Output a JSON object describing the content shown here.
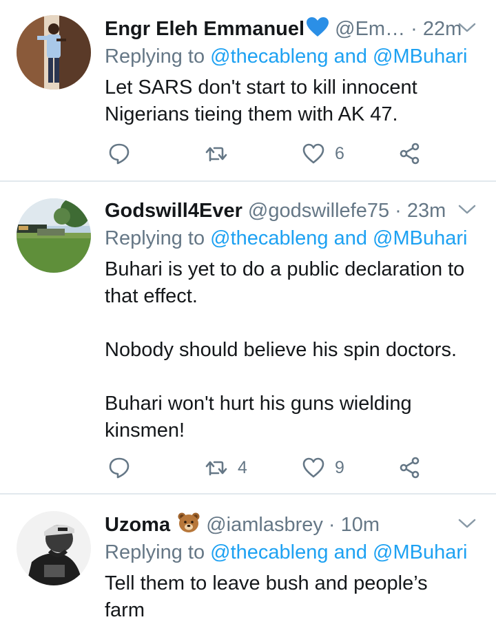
{
  "tweets": [
    {
      "name": "Engr Eleh Emmanuel",
      "badge": "blue-heart",
      "handle": "@Em…",
      "time": "· 22m",
      "replying_prefix": "Replying to",
      "mention_1": "@thecableng",
      "and": "and",
      "mention_2": "@MBuhari",
      "paragraphs": [
        "Let SARS don't start  to kill innocent Nigerians  tieing   them with AK 47."
      ],
      "reply_count": "",
      "retweet_count": "",
      "like_count": "6"
    },
    {
      "name": "Godswill4Ever",
      "badge": "",
      "handle": "@godswillefe75",
      "time": "· 23m",
      "replying_prefix": "Replying to",
      "mention_1": "@thecableng",
      "and": "and",
      "mention_2": "@MBuhari",
      "paragraphs": [
        "Buhari is yet to do a public declaration to that effect.",
        "Nobody should believe his spin doctors.",
        "Buhari won't hurt his guns wielding kinsmen!"
      ],
      "reply_count": "",
      "retweet_count": "4",
      "like_count": "9"
    },
    {
      "name": "Uzoma",
      "badge": "bear-face",
      "handle": "@iamlasbrey",
      "time": "· 10m",
      "replying_prefix": "Replying to",
      "mention_1": "@thecableng",
      "and": "and",
      "mention_2": "@MBuhari",
      "paragraphs": [
        "Tell them to leave bush and people’s farm"
      ],
      "reply_count": "",
      "retweet_count": "",
      "like_count": ""
    }
  ],
  "colors": {
    "name": "#14171a",
    "secondary": "#657786",
    "link": "#1da1f2",
    "divider": "#e1e8ed",
    "icon": "#657786"
  }
}
